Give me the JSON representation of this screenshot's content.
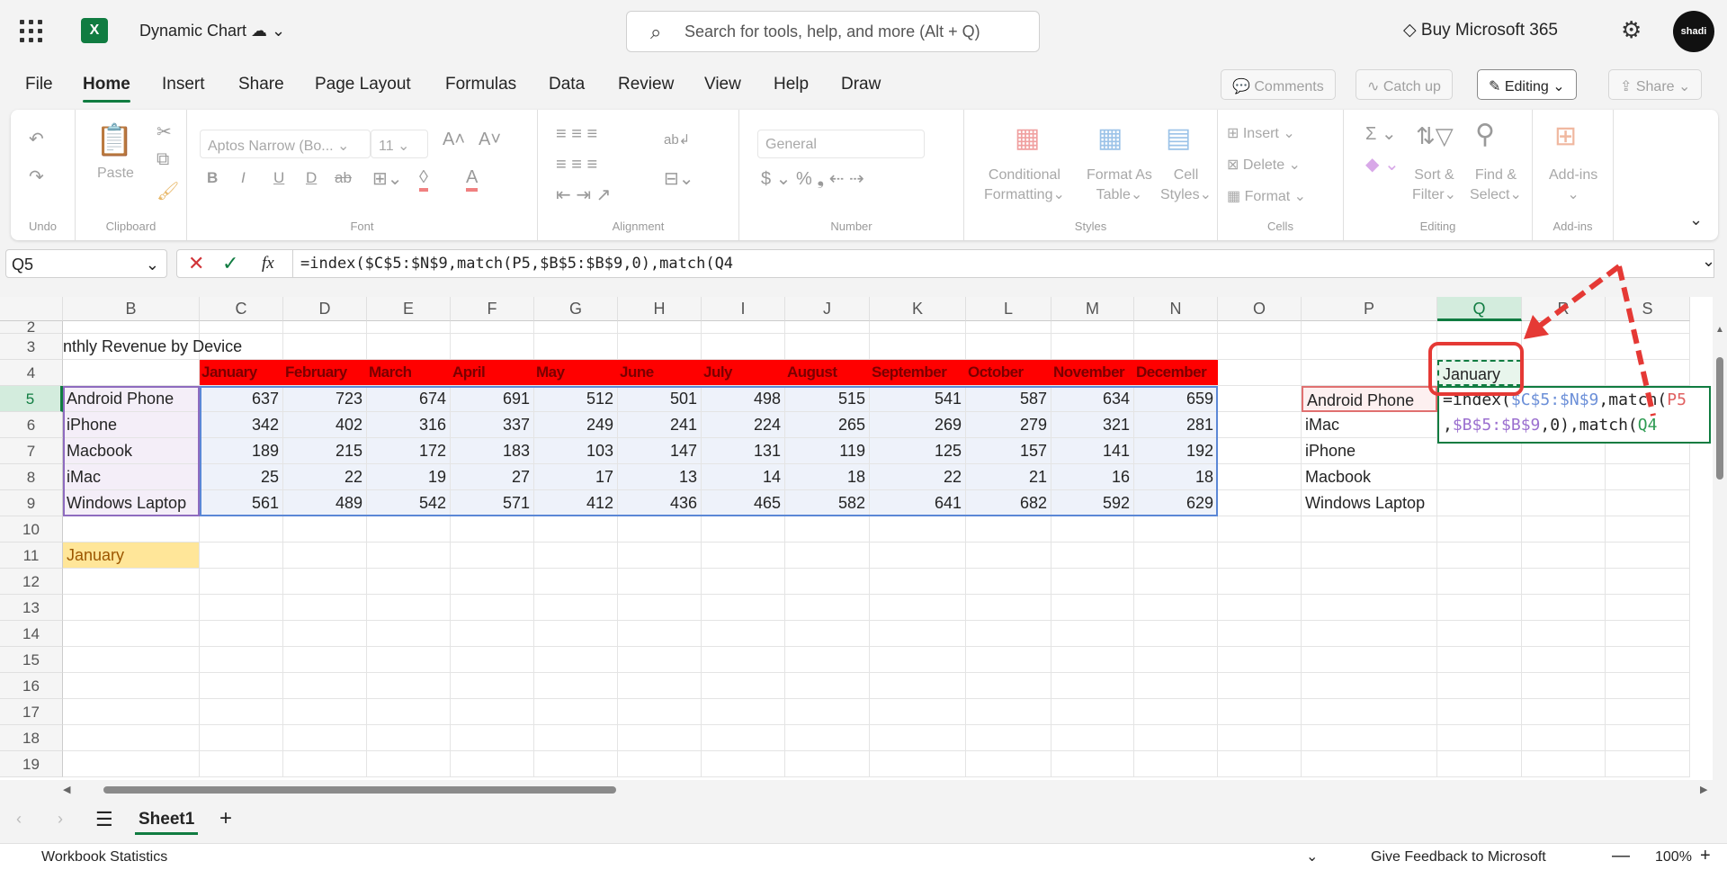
{
  "app": {
    "title": "Dynamic Chart",
    "search_placeholder": "Search for tools, help, and more (Alt + Q)",
    "buy": "Buy Microsoft 365",
    "avatar_text": "shadi"
  },
  "menu": [
    "File",
    "Home",
    "Insert",
    "Share",
    "Page Layout",
    "Formulas",
    "Data",
    "Review",
    "View",
    "Help",
    "Draw"
  ],
  "menu_active": "Home",
  "right_buttons": {
    "comments": "Comments",
    "catchup": "Catch up",
    "editing": "Editing",
    "share": "Share"
  },
  "ribbon": {
    "groups": {
      "undo": "Undo",
      "clipboard": "Clipboard",
      "font": "Font",
      "alignment": "Alignment",
      "number": "Number",
      "styles": "Styles",
      "cells": "Cells",
      "editing": "Editing",
      "addins": "Add-ins"
    },
    "paste": "Paste",
    "font_name": "Aptos Narrow (Bo...",
    "font_size": "11",
    "number_format": "General",
    "conditional": [
      "Conditional",
      "Formatting"
    ],
    "format_table": [
      "Format As",
      "Table"
    ],
    "cell_styles": [
      "Cell",
      "Styles"
    ],
    "insert": "Insert",
    "delete": "Delete",
    "format": "Format",
    "sort": [
      "Sort &",
      "Filter"
    ],
    "find": [
      "Find &",
      "Select"
    ],
    "addins_btn": "Add-ins"
  },
  "formula_bar": {
    "name_box": "Q5",
    "formula": "=index($C$5:$N$9,match(P5,$B$5:$B$9,0),match(Q4"
  },
  "sheet": {
    "columns": [
      "B",
      "C",
      "D",
      "E",
      "F",
      "G",
      "H",
      "I",
      "J",
      "K",
      "L",
      "M",
      "N",
      "O",
      "P",
      "Q",
      "R",
      "S"
    ],
    "selected_column": "Q",
    "selected_row": 5,
    "rows": [
      2,
      3,
      4,
      5,
      6,
      7,
      8,
      9,
      10,
      11,
      12,
      13,
      14,
      15,
      16,
      17,
      18,
      19
    ],
    "title": "nthly Revenue by Device",
    "months": [
      "January",
      "February",
      "March",
      "April",
      "May",
      "June",
      "July",
      "August",
      "September",
      "October",
      "November",
      "December"
    ],
    "devices": [
      "Android Phone",
      "iPhone",
      "Macbook",
      "iMac",
      "Windows Laptop"
    ],
    "values": [
      [
        637,
        723,
        674,
        691,
        512,
        501,
        498,
        515,
        541,
        587,
        634,
        659
      ],
      [
        342,
        402,
        316,
        337,
        249,
        241,
        224,
        265,
        269,
        279,
        321,
        281
      ],
      [
        189,
        215,
        172,
        183,
        103,
        147,
        131,
        119,
        125,
        157,
        141,
        192
      ],
      [
        25,
        22,
        19,
        27,
        17,
        13,
        14,
        18,
        22,
        21,
        16,
        18
      ],
      [
        561,
        489,
        542,
        571,
        412,
        436,
        465,
        582,
        641,
        682,
        592,
        629
      ]
    ],
    "b11": "January",
    "p_list": [
      "Android Phone",
      "iMac",
      "iPhone",
      "Macbook",
      "Windows Laptop"
    ],
    "q4": "January",
    "edit_line1": [
      {
        "t": "=index(",
        "c": "#242424"
      },
      {
        "t": "$C$5:$N$9",
        "c": "#6b8fd8"
      },
      {
        "t": ",match(",
        "c": "#242424"
      },
      {
        "t": "P5",
        "c": "#e06060"
      }
    ],
    "edit_line2": [
      {
        "t": ",",
        "c": "#242424"
      },
      {
        "t": "$B$5:$B$9",
        "c": "#9b6fcf"
      },
      {
        "t": ",0),match(",
        "c": "#242424"
      },
      {
        "t": "Q4",
        "c": "#2e9b52"
      }
    ]
  },
  "colors": {
    "accent": "#107c41",
    "header_fill": "#ff0000",
    "annotation": "#e53935"
  },
  "tabs": {
    "sheet": "Sheet1"
  },
  "status": {
    "left": "Workbook Statistics",
    "feedback": "Give Feedback to Microsoft",
    "zoom": "100%"
  }
}
